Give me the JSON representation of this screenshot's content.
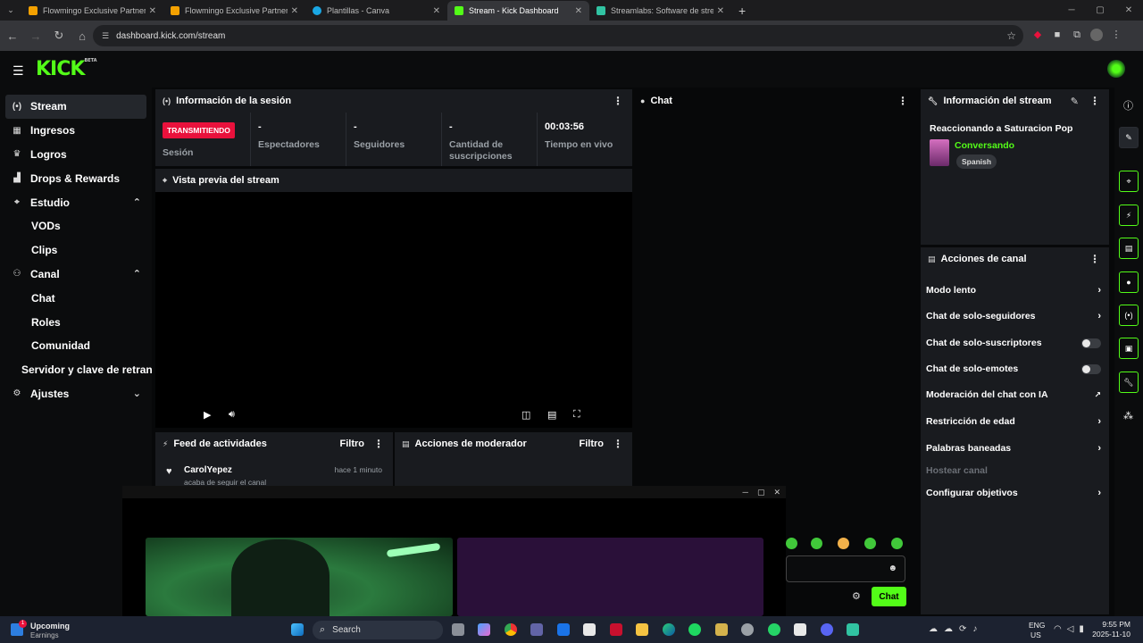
{
  "browser": {
    "tabs": [
      {
        "title": "Flowmingo Exclusive Partner Hu",
        "color": "#f4a100",
        "active": false
      },
      {
        "title": "Flowmingo Exclusive Partner Hu",
        "color": "#f4a100",
        "active": false
      },
      {
        "title": "Plantillas - Canva",
        "color": "#1aa7e4",
        "active": false
      },
      {
        "title": "Stream - Kick Dashboard",
        "color": "#53fc18",
        "active": true
      },
      {
        "title": "Streamlabs: Software de stream",
        "color": "#31c3a2",
        "active": false
      }
    ],
    "url": "dashboard.kick.com/stream"
  },
  "header": {
    "logo": "KICK",
    "logo_sup": "BETA"
  },
  "sidebar": {
    "items": [
      {
        "label": "Stream",
        "icon": "broadcast-icon"
      },
      {
        "label": "Ingresos",
        "icon": "money-icon"
      },
      {
        "label": "Logros",
        "icon": "trophy-icon"
      },
      {
        "label": "Drops & Rewards",
        "icon": "gift-icon"
      },
      {
        "label": "Estudio",
        "icon": "studio-icon"
      },
      {
        "label": "VODs"
      },
      {
        "label": "Clips"
      },
      {
        "label": "Canal",
        "icon": "channel-icon"
      },
      {
        "label": "Chat"
      },
      {
        "label": "Roles"
      },
      {
        "label": "Comunidad"
      },
      {
        "label": "Servidor y clave de retransmisión"
      },
      {
        "label": "Ajustes",
        "icon": "settings-icon"
      }
    ]
  },
  "session": {
    "title": "Información de la sesión",
    "live_badge": "TRANSMITIENDO",
    "stats": [
      {
        "value": "",
        "label": "Sesión"
      },
      {
        "value": "-",
        "label": "Espectadores"
      },
      {
        "value": "-",
        "label": "Seguidores"
      },
      {
        "value": "-",
        "label": "Cantidad de suscripciones"
      },
      {
        "value": "00:03:56",
        "label": "Tiempo en vivo"
      }
    ]
  },
  "preview": {
    "title": "Vista previa del stream"
  },
  "feed": {
    "title": "Feed de actividades",
    "filter": "Filtro",
    "item": {
      "user": "CarolYepez",
      "time": "hace 1 minuto",
      "text": "acaba de seguir el canal"
    }
  },
  "mod": {
    "title": "Acciones de moderador",
    "filter": "Filtro"
  },
  "chat": {
    "title": "Chat",
    "send": "Chat"
  },
  "stream_info": {
    "title": "Información del stream",
    "stream_title": "Reaccionando a Saturacion Pop",
    "category": "Conversando",
    "language": "Spanish"
  },
  "channel_actions": {
    "title": "Acciones de canal",
    "rows": [
      {
        "label": "Modo lento",
        "kind": "arrow"
      },
      {
        "label": "Chat de solo-seguidores",
        "kind": "arrow"
      },
      {
        "label": "Chat de solo-suscriptores",
        "kind": "toggle"
      },
      {
        "label": "Chat de solo-emotes",
        "kind": "toggle"
      },
      {
        "label": "Moderación del chat con IA",
        "kind": "external"
      },
      {
        "label": "Restricción de edad",
        "kind": "arrow"
      },
      {
        "label": "Palabras baneadas",
        "kind": "arrow"
      },
      {
        "label": "Hostear canal",
        "kind": "disabled"
      },
      {
        "label": "Configurar objetivos",
        "kind": "arrow"
      }
    ]
  },
  "taskbar": {
    "weather_title": "Upcoming",
    "weather_sub": "Earnings",
    "weather_badge": "1",
    "search": "Search",
    "lang1": "ENG",
    "lang2": "US",
    "time": "9:55 PM",
    "date": "2025-11-10"
  },
  "colors": {
    "kick_green": "#53fc18",
    "live_red": "#e9113c"
  }
}
